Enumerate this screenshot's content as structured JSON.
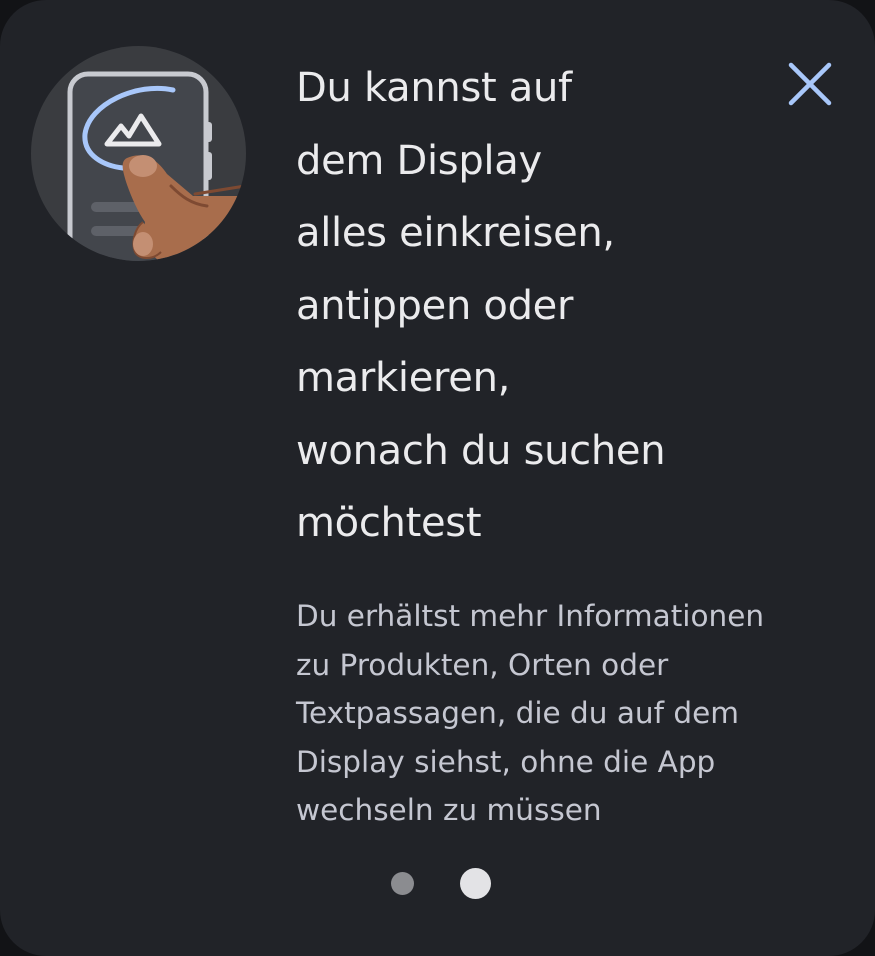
{
  "dialog": {
    "illustration_icon": "circle-to-search-illustration",
    "close_icon": "close-icon",
    "title_lines": [
      "Du kannst auf",
      "dem Display",
      "alles einkreisen,",
      "antippen oder",
      "markieren,",
      "wonach du suchen",
      "möchtest"
    ],
    "description_lines": [
      "Du erhältst mehr Informationen",
      "zu Produkten, Orten oder",
      "Textpassagen, die du auf dem",
      "Display siehst, ohne die App",
      "wechseln zu müssen"
    ]
  },
  "pagination": {
    "page_count": 2,
    "current_page": 2
  },
  "colors": {
    "card_background": "#212328",
    "accent": "#a8c7fa",
    "title_text": "#ebebed",
    "body_text": "#c5c7d1"
  }
}
